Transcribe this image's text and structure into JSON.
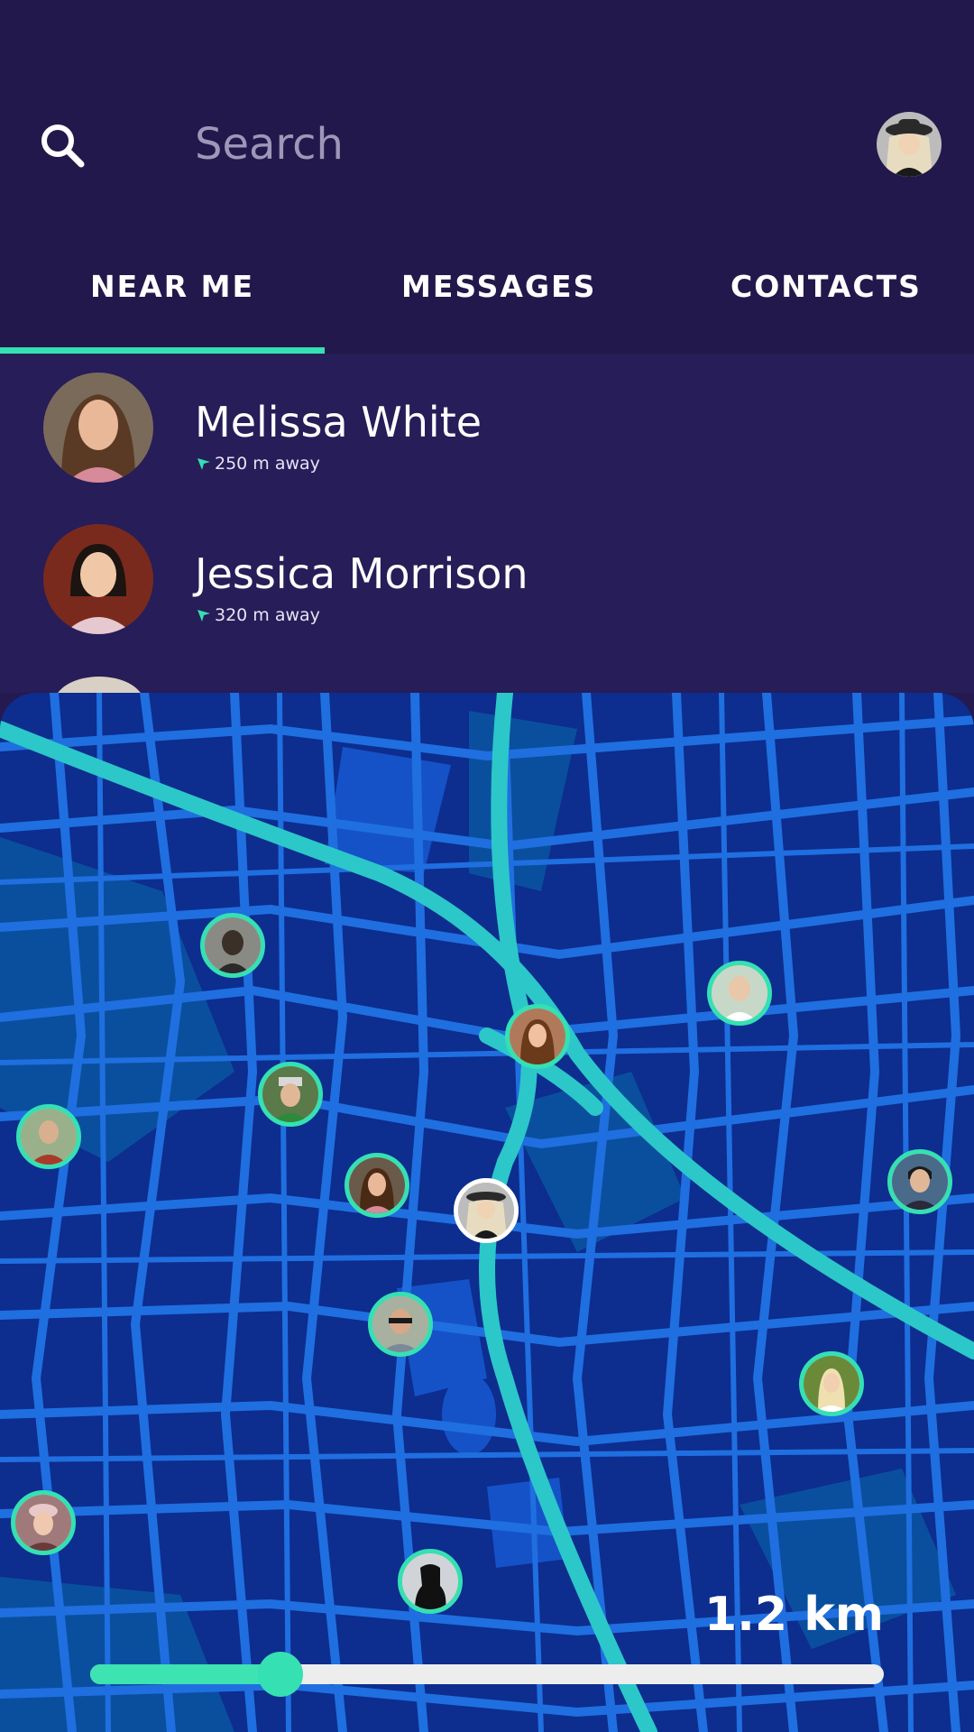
{
  "header": {
    "search_placeholder": "Search",
    "icons": {
      "search": "search-icon",
      "profile": "avatar"
    }
  },
  "tabs": [
    {
      "label": "NEAR ME",
      "active": true
    },
    {
      "label": "MESSAGES",
      "active": false
    },
    {
      "label": "CONTACTS",
      "active": false
    }
  ],
  "contacts": [
    {
      "name": "Melissa White",
      "distance": "250 m away"
    },
    {
      "name": "Jessica Morrison",
      "distance": "320 m away"
    }
  ],
  "map": {
    "radius_label": "1.2 km",
    "slider_fraction": 0.24
  },
  "colors": {
    "accent": "#35e0b2",
    "header_bg": "#23184b",
    "list_bg": "#271d58",
    "map_bg": "#0d2d8f",
    "street": "#1f6fe0",
    "highway": "#2cc7c9"
  }
}
